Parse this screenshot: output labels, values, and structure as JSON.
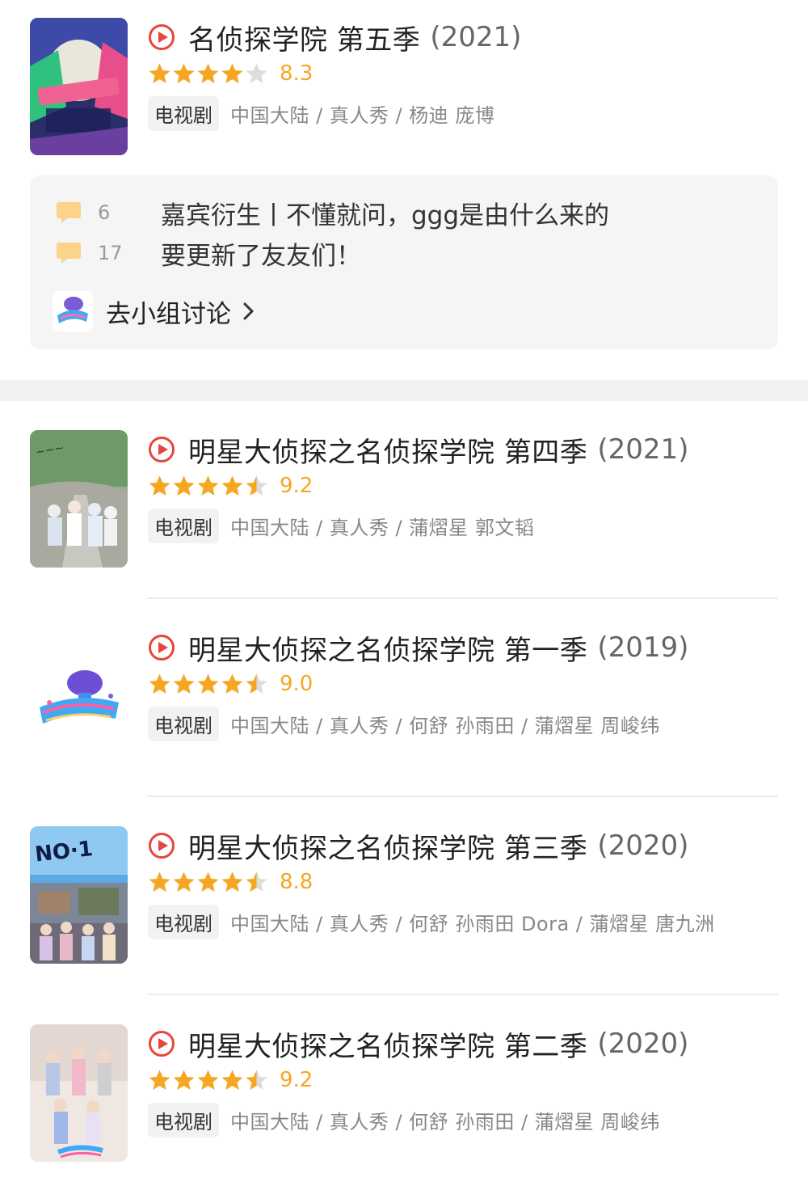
{
  "items": [
    {
      "title": "名侦探学院 第五季",
      "year": "(2021)",
      "rating": 8.3,
      "stars": 4,
      "score": "8.3",
      "tag": "电视剧",
      "meta": "中国大陆 / 真人秀 / 杨迪 庞博",
      "poster_icon": "season5-poster"
    },
    {
      "title": "明星大侦探之名侦探学院 第四季",
      "year": "(2021)",
      "rating": 9.2,
      "stars": 4.5,
      "score": "9.2",
      "tag": "电视剧",
      "meta": "中国大陆 / 真人秀 / 蒲熠星 郭文韬",
      "poster_icon": "season4-poster"
    },
    {
      "title": "明星大侦探之名侦探学院 第一季",
      "year": "(2019)",
      "rating": 9.0,
      "stars": 4.5,
      "score": "9.0",
      "tag": "电视剧",
      "meta": "中国大陆 / 真人秀 / 何舒 孙雨田 / 蒲熠星 周峻纬",
      "poster_icon": "season1-logo"
    },
    {
      "title": "明星大侦探之名侦探学院 第三季",
      "year": "(2020)",
      "rating": 8.8,
      "stars": 4.5,
      "score": "8.8",
      "tag": "电视剧",
      "meta": "中国大陆 / 真人秀 / 何舒 孙雨田 Dora / 蒲熠星 唐九洲",
      "poster_icon": "season3-poster"
    },
    {
      "title": "明星大侦探之名侦探学院 第二季",
      "year": "(2020)",
      "rating": 9.2,
      "stars": 4.5,
      "score": "9.2",
      "tag": "电视剧",
      "meta": "中国大陆 / 真人秀 / 何舒 孙雨田 / 蒲熠星 周峻纬",
      "poster_icon": "season2-poster"
    }
  ],
  "group": {
    "posts": [
      {
        "count": "6",
        "title": "嘉宾衍生丨不懂就问，ggg是由什么来的"
      },
      {
        "count": "17",
        "title": "要更新了友友们！"
      }
    ],
    "link_label": "去小组讨论"
  },
  "colors": {
    "star": "#f5a623",
    "star_empty": "#dddddd",
    "play": "#e8463c",
    "bubble": "#fbd38a"
  }
}
